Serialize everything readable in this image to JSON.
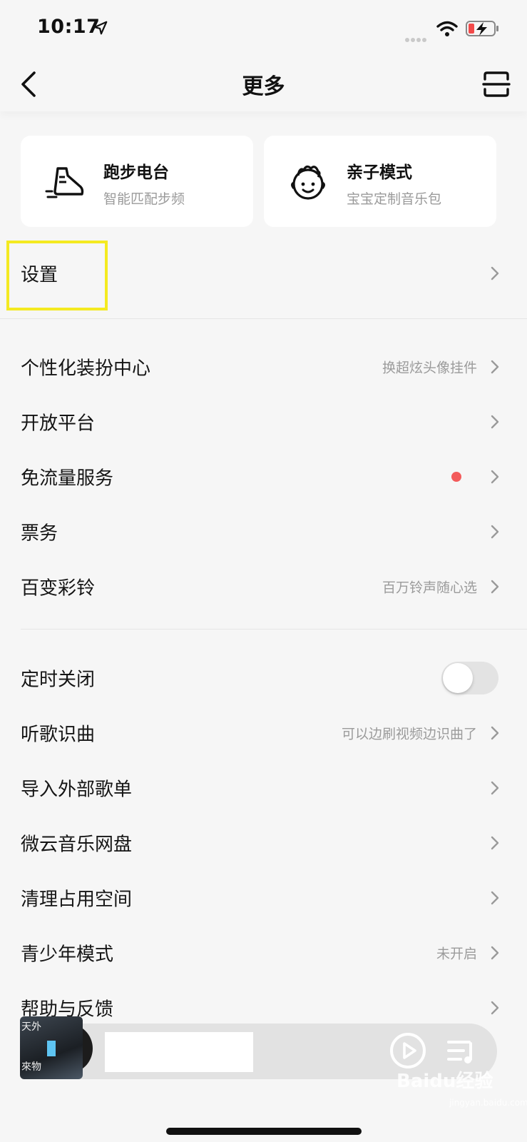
{
  "status": {
    "time": "10:17"
  },
  "nav": {
    "title": "更多"
  },
  "cards": [
    {
      "title": "跑步电台",
      "subtitle": "智能匹配步频"
    },
    {
      "title": "亲子模式",
      "subtitle": "宝宝定制音乐包"
    }
  ],
  "settings": {
    "label": "设置"
  },
  "group1": [
    {
      "label": "个性化装扮中心",
      "hint": "换超炫头像挂件"
    },
    {
      "label": "开放平台",
      "hint": ""
    },
    {
      "label": "免流量服务",
      "hint": ""
    },
    {
      "label": "票务",
      "hint": ""
    },
    {
      "label": "百变彩铃",
      "hint": "百万铃声随心选"
    }
  ],
  "group2": [
    {
      "label": "定时关闭"
    },
    {
      "label": "听歌识曲",
      "hint": "可以边刷视频边识曲了"
    },
    {
      "label": "导入外部歌单",
      "hint": ""
    },
    {
      "label": "微云音乐网盘",
      "hint": ""
    },
    {
      "label": "清理占用空间",
      "hint": ""
    },
    {
      "label": "青少年模式",
      "hint": "未开启"
    },
    {
      "label": "帮助与反馈",
      "hint": ""
    }
  ],
  "timer_toggle": {
    "on": false
  },
  "player": {
    "album_text_top": "天外",
    "album_text_bottom": "來物"
  },
  "watermark": {
    "text": "Baidu经验",
    "sub": "jingyan.baidu.com"
  },
  "colors": {
    "accent_highlight": "#f4ea21",
    "red_dot": "#f35b5b"
  }
}
